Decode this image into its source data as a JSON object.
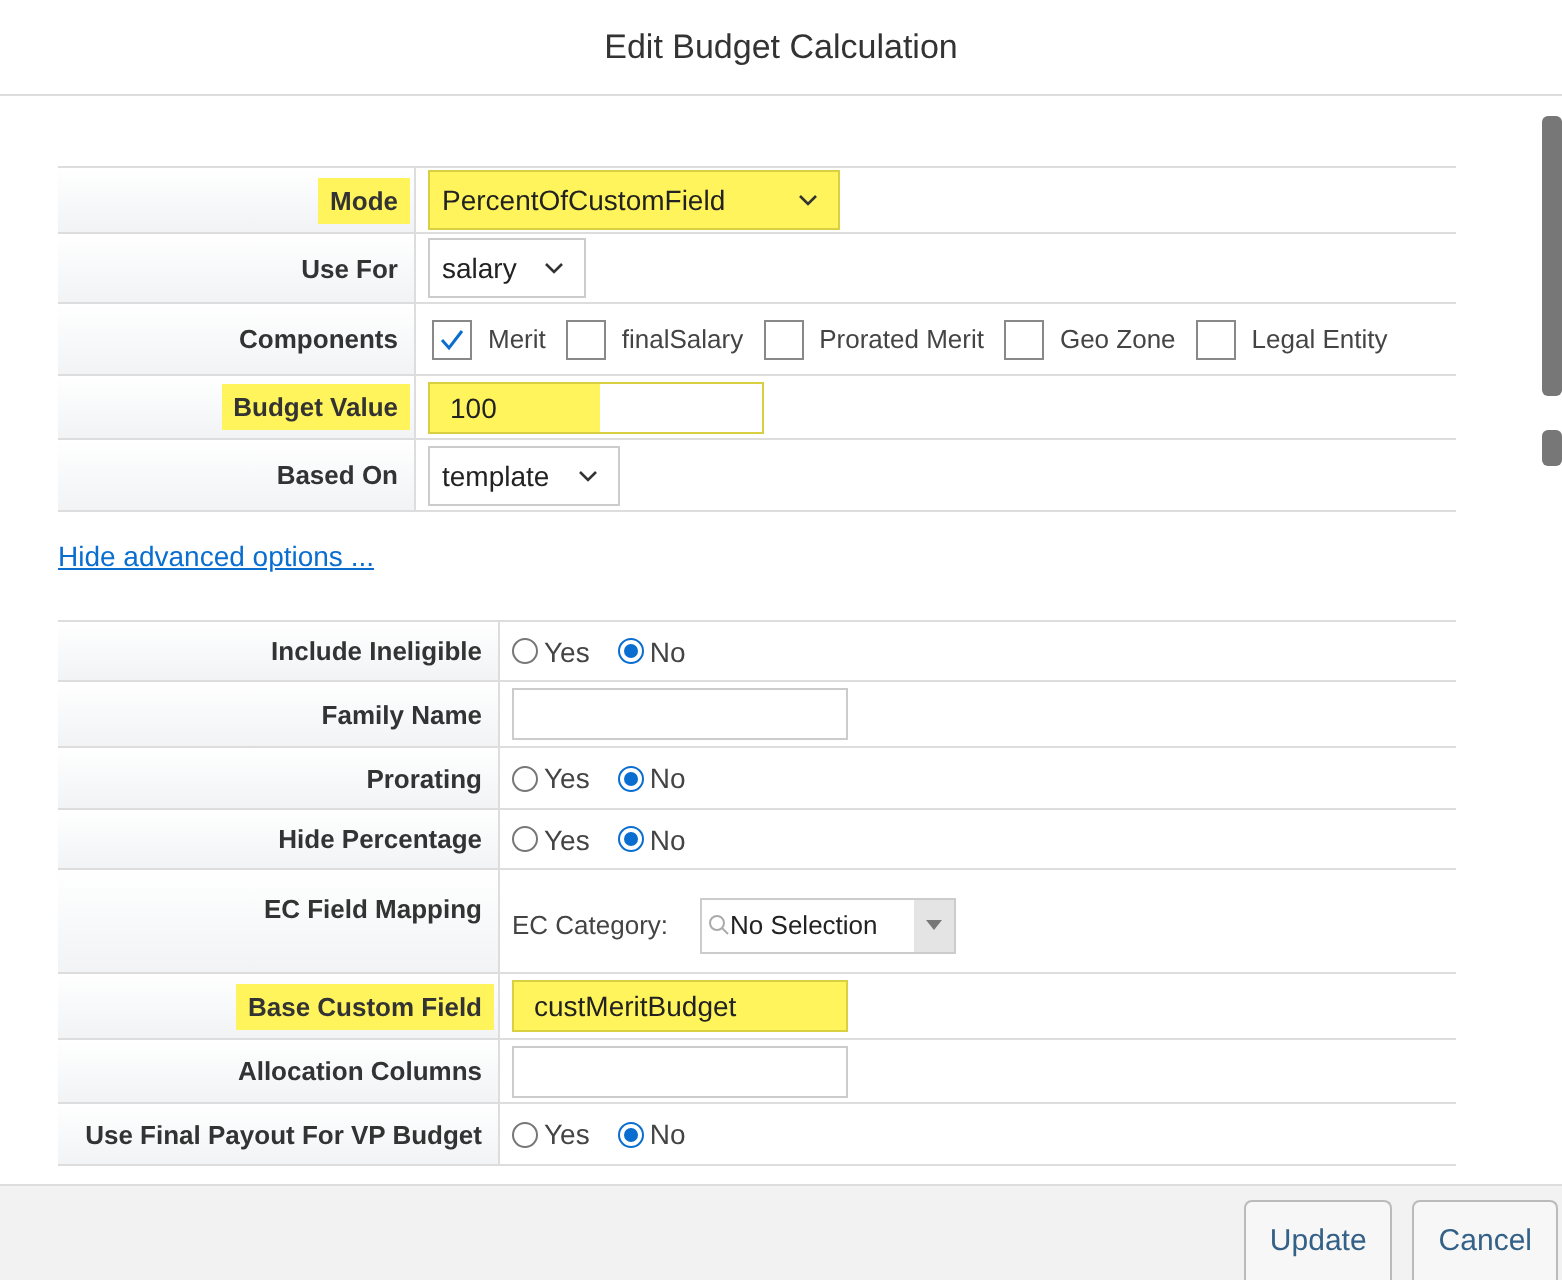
{
  "window": {
    "title": "Edit Budget Calculation"
  },
  "main_rows": [
    {
      "label": "Mode",
      "kind": "select",
      "value": "PercentOfCustomField",
      "highlighted": true
    },
    {
      "label": "Use For",
      "kind": "select",
      "value": "salary",
      "highlighted": false
    },
    {
      "label": "Components",
      "kind": "checkboxes",
      "options": [
        {
          "label": "Merit",
          "checked": true
        },
        {
          "label": "finalSalary",
          "checked": false
        },
        {
          "label": "Prorated Merit",
          "checked": false
        },
        {
          "label": "Geo Zone",
          "checked": false
        },
        {
          "label": "Legal Entity",
          "checked": false
        }
      ],
      "highlighted": false
    },
    {
      "label": "Budget Value",
      "kind": "text",
      "value": "100",
      "highlighted": true
    },
    {
      "label": "Based On",
      "kind": "select",
      "value": "template",
      "highlighted": false
    }
  ],
  "advanced_link": "Hide advanced options ...",
  "advanced_rows": [
    {
      "label": "Include Ineligible",
      "kind": "radio",
      "options": [
        {
          "label": "Yes",
          "selected": false
        },
        {
          "label": "No",
          "selected": true
        }
      ],
      "highlighted": false
    },
    {
      "label": "Family Name",
      "kind": "text",
      "value": "",
      "highlighted": false
    },
    {
      "label": "Prorating",
      "kind": "radio",
      "options": [
        {
          "label": "Yes",
          "selected": false
        },
        {
          "label": "No",
          "selected": true
        }
      ],
      "highlighted": false
    },
    {
      "label": "Hide Percentage",
      "kind": "radio",
      "options": [
        {
          "label": "Yes",
          "selected": false
        },
        {
          "label": "No",
          "selected": true
        }
      ],
      "highlighted": false
    },
    {
      "label": "EC Field Mapping",
      "kind": "mapping",
      "sublabel": "EC Category:",
      "value": "No Selection",
      "highlighted": false
    },
    {
      "label": "Base Custom Field",
      "kind": "text",
      "value": "custMeritBudget",
      "highlighted": true
    },
    {
      "label": "Allocation Columns",
      "kind": "text",
      "value": "",
      "highlighted": false
    },
    {
      "label": "Use Final Payout For VP Budget",
      "kind": "radio",
      "options": [
        {
          "label": "Yes",
          "selected": false
        },
        {
          "label": "No",
          "selected": true
        }
      ],
      "highlighted": false
    }
  ],
  "buttons": [
    "Update",
    "Cancel"
  ]
}
